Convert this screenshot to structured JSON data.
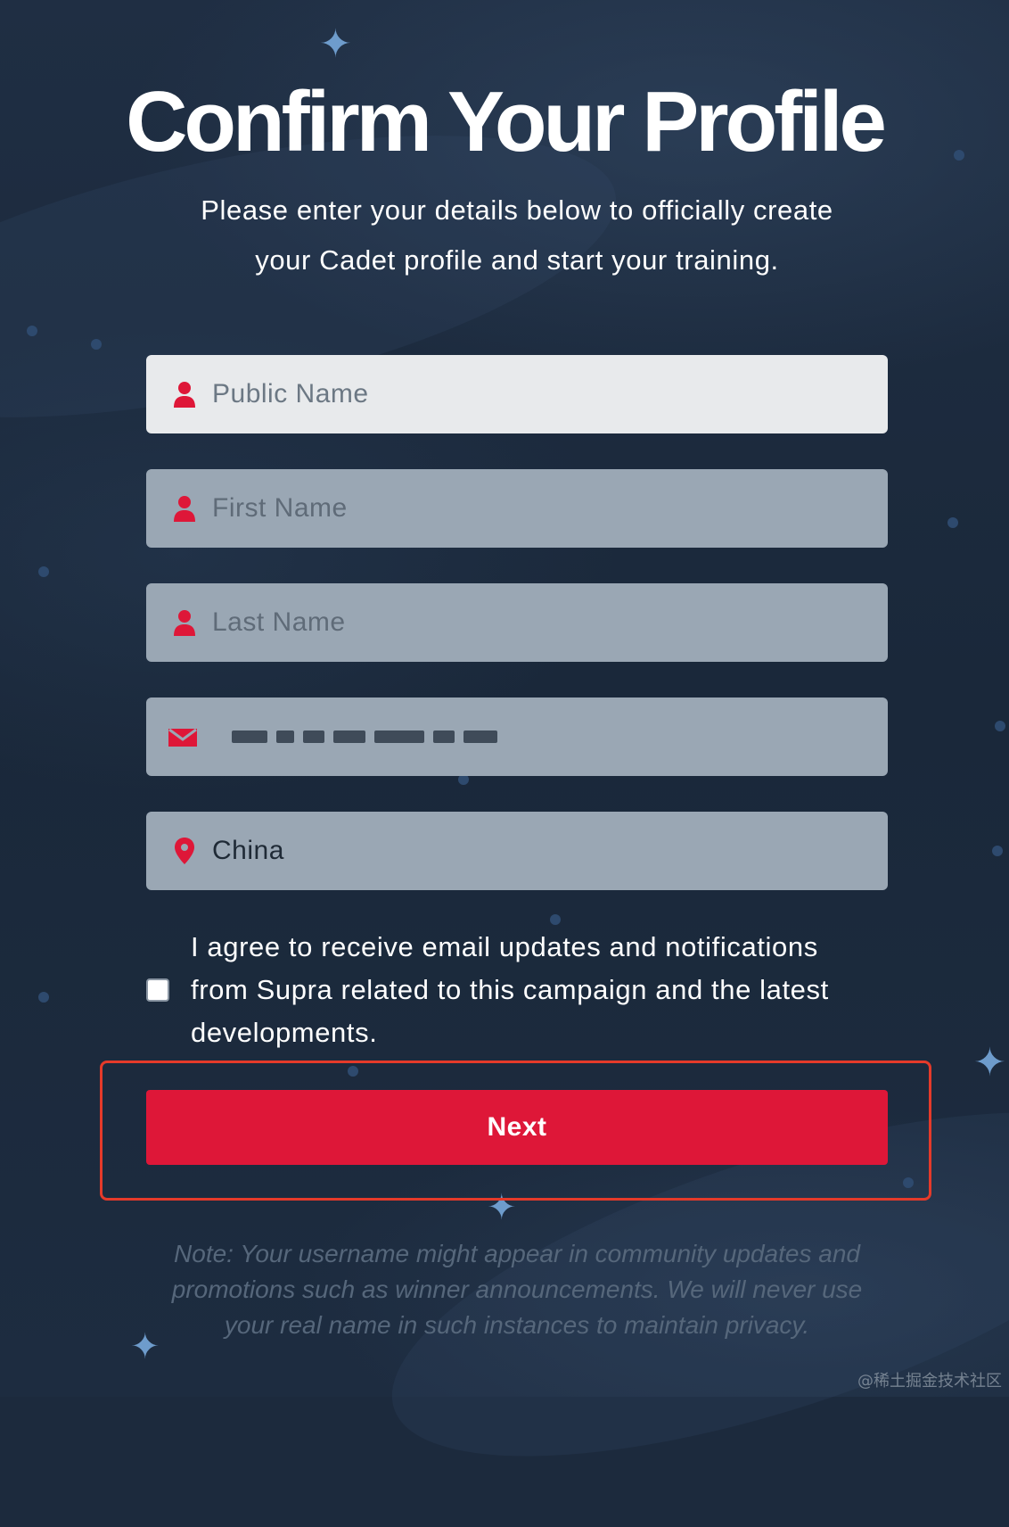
{
  "header": {
    "title": "Confirm Your Profile",
    "subtitle_line1": "Please enter your details below to officially create",
    "subtitle_line2": "your Cadet profile and start your training."
  },
  "form": {
    "public_name": {
      "placeholder": "Public Name",
      "value": "",
      "icon": "user-icon"
    },
    "first_name": {
      "placeholder": "First Name",
      "value": "",
      "icon": "user-icon"
    },
    "last_name": {
      "placeholder": "Last Name",
      "value": "",
      "icon": "user-icon"
    },
    "email": {
      "value_obscured": true,
      "icon": "envelope-icon"
    },
    "country": {
      "value": "China",
      "icon": "map-pin-icon"
    },
    "consent": {
      "checked": false,
      "line1": "I agree to receive email updates and notifications",
      "line2": "from Supra related to this campaign and the latest",
      "line3": "developments."
    },
    "next_label": "Next"
  },
  "note": {
    "line1": "Note: Your username might appear in community updates and",
    "line2": "promotions such as winner announcements. We will never use",
    "line3": "your real name in such instances to maintain privacy."
  },
  "watermark": "@稀土掘金技术社区",
  "colors": {
    "background": "#1c2a3d",
    "accent": "#de1738",
    "field_bg": "#9aa7b4",
    "field_active_bg": "#e8eaec",
    "highlight_border": "#e53a2a",
    "note_text": "#56677b"
  }
}
